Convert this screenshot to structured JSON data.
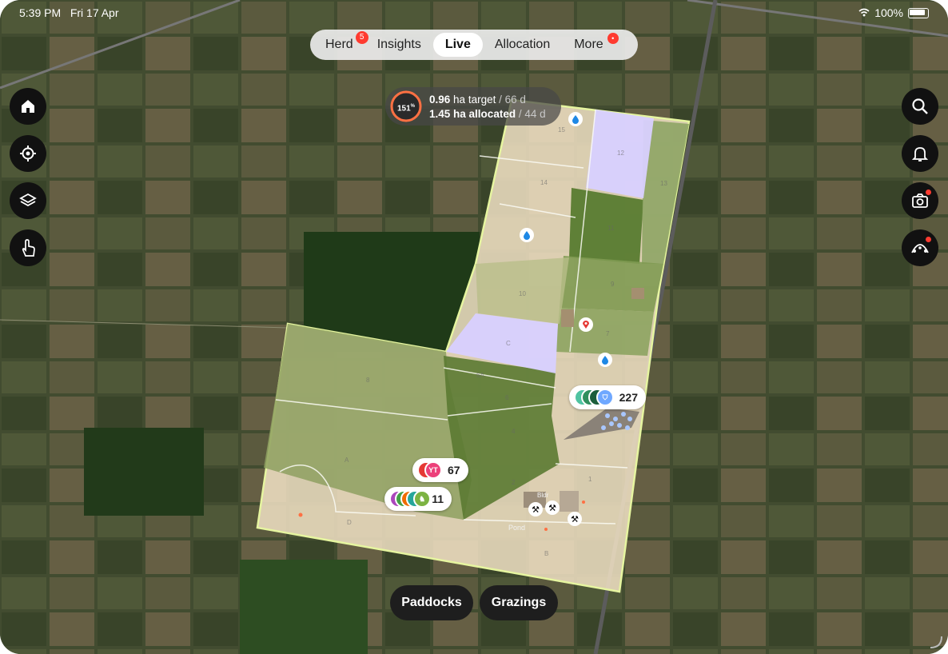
{
  "status_bar": {
    "time": "5:39 PM",
    "date": "Fri 17 Apr",
    "battery": "100%"
  },
  "tabs": [
    {
      "label": "Herd",
      "badge": "5"
    },
    {
      "label": "Insights"
    },
    {
      "label": "Live",
      "active": true
    },
    {
      "label": "Allocation"
    },
    {
      "label": "More",
      "badge": "•"
    }
  ],
  "left_controls": [
    "home-icon",
    "locate-icon",
    "layers-icon",
    "touch-icon"
  ],
  "right_controls": [
    "search-icon",
    "bell-icon",
    "camera-icon",
    "route-icon"
  ],
  "target": {
    "percent": "151",
    "percent_unit": "%",
    "target_value": "0.96",
    "target_label": "ha target",
    "target_days": "/ 66 d",
    "allocated_value": "1.45",
    "allocated_label": "ha allocated",
    "allocated_days": "/ 44 d"
  },
  "herds": [
    {
      "count": "227",
      "avatars": [
        "#4fc3a1",
        "#2f8f5e",
        "#1b5e3a",
        "#6fa8ff"
      ]
    },
    {
      "count": "67",
      "avatars": [
        "#e53935",
        "#ec407a"
      ],
      "initials": "YT"
    },
    {
      "count": "11",
      "avatars": [
        "#ab47bc",
        "#43a047",
        "#ef6c00",
        "#26a69a",
        "#7cb342"
      ]
    }
  ],
  "paddocks": [
    "15",
    "14",
    "13",
    "12",
    "11",
    "10",
    "9",
    "8",
    "7",
    "6A",
    "6",
    "5",
    "4",
    "3",
    "2",
    "1",
    "A",
    "B",
    "C",
    "D"
  ],
  "map_labels": {
    "pond": "Pond",
    "bldg": "Bldr"
  },
  "bottom_buttons": {
    "paddocks": "Paddocks",
    "grazings": "Grazings"
  },
  "colors": {
    "accent_ring": "#ff7043",
    "badge": "#ff3b30",
    "farm_outline": "#e6f5a0",
    "allocated_fill": "#d8d0ff"
  }
}
